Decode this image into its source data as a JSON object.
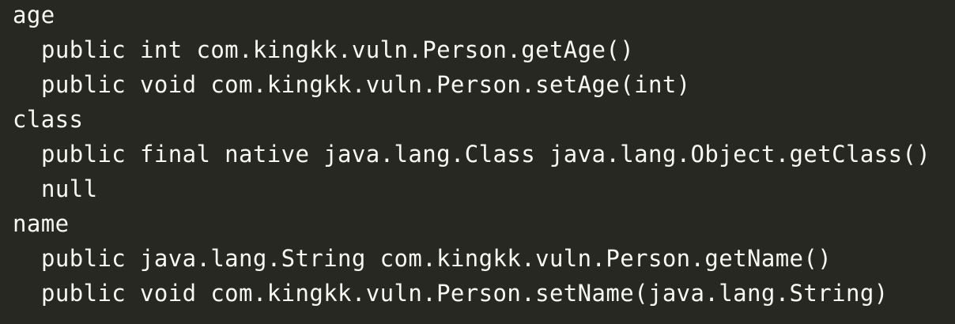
{
  "code_lines": [
    {
      "text": "age",
      "indent": 0
    },
    {
      "text": "public int com.kingkk.vuln.Person.getAge()",
      "indent": 1
    },
    {
      "text": "public void com.kingkk.vuln.Person.setAge(int)",
      "indent": 1
    },
    {
      "text": "class",
      "indent": 0
    },
    {
      "text": "public final native java.lang.Class java.lang.Object.getClass()",
      "indent": 1
    },
    {
      "text": "null",
      "indent": 1
    },
    {
      "text": "name",
      "indent": 0
    },
    {
      "text": "public java.lang.String com.kingkk.vuln.Person.getName()",
      "indent": 1
    },
    {
      "text": "public void com.kingkk.vuln.Person.setName(java.lang.String)",
      "indent": 1
    }
  ],
  "colors": {
    "background": "#272822",
    "text": "#f8f8f2"
  }
}
